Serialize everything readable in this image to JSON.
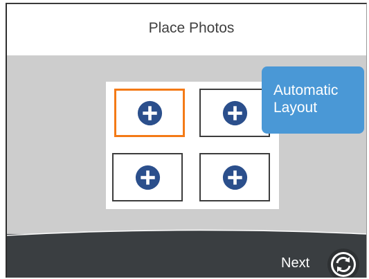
{
  "header": {
    "title": "Place Photos"
  },
  "layout": {
    "slots": [
      {
        "icon": "plus-circle-icon",
        "selected": true
      },
      {
        "icon": "plus-circle-icon",
        "selected": false
      },
      {
        "icon": "plus-circle-icon",
        "selected": false
      },
      {
        "icon": "plus-circle-icon",
        "selected": false
      }
    ],
    "automatic_layout_button": {
      "line1": "Automatic",
      "line2": "Layout"
    }
  },
  "footer": {
    "next_label": "Next",
    "refresh_icon": "refresh-icon"
  },
  "colors": {
    "selected_border": "#f47a16",
    "plus_icon": "#2b4f8c",
    "button_blue": "#4a98d6",
    "footer_bg": "#3a3e41"
  }
}
